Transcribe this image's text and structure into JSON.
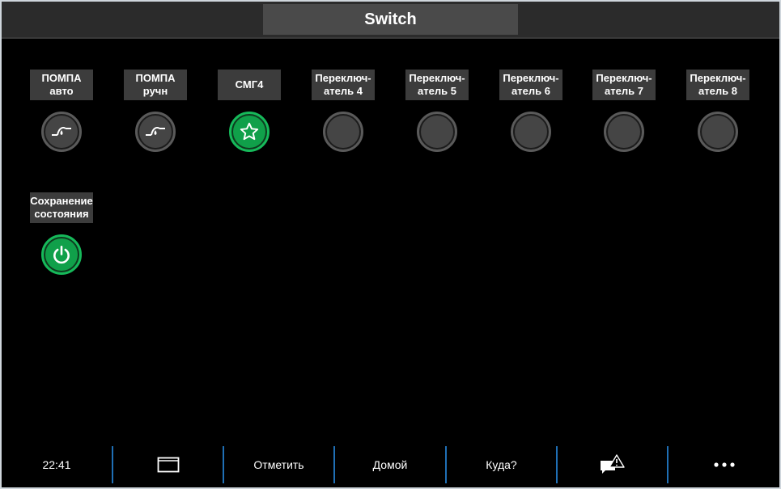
{
  "header": {
    "title": "Switch"
  },
  "switches": [
    {
      "label": "ПОМПА\nавто",
      "icon": "pump-icon",
      "active": false
    },
    {
      "label": "ПОМПА\nручн",
      "icon": "pump-icon",
      "active": false
    },
    {
      "label": "СМГ4",
      "icon": "star-icon",
      "active": true
    },
    {
      "label": "Переключ-\nатель 4",
      "icon": "none",
      "active": false
    },
    {
      "label": "Переключ-\nатель 5",
      "icon": "none",
      "active": false
    },
    {
      "label": "Переключ-\nатель 6",
      "icon": "none",
      "active": false
    },
    {
      "label": "Переключ-\nатель 7",
      "icon": "none",
      "active": false
    },
    {
      "label": "Переключ-\nатель 8",
      "icon": "none",
      "active": false
    },
    {
      "label": "Сохранение\nсостояния",
      "icon": "power-icon",
      "active": true
    }
  ],
  "bottom_bar": {
    "time": "22:41",
    "screen_icon": "display-icon",
    "mark_label": "Отметить",
    "home_label": "Домой",
    "where_label": "Куда?",
    "alerts_icon": "alert-chat-icon",
    "more_icon": "more-icon"
  },
  "colors": {
    "active_green": "#10a04a",
    "separator_blue": "#1f6fb5"
  }
}
